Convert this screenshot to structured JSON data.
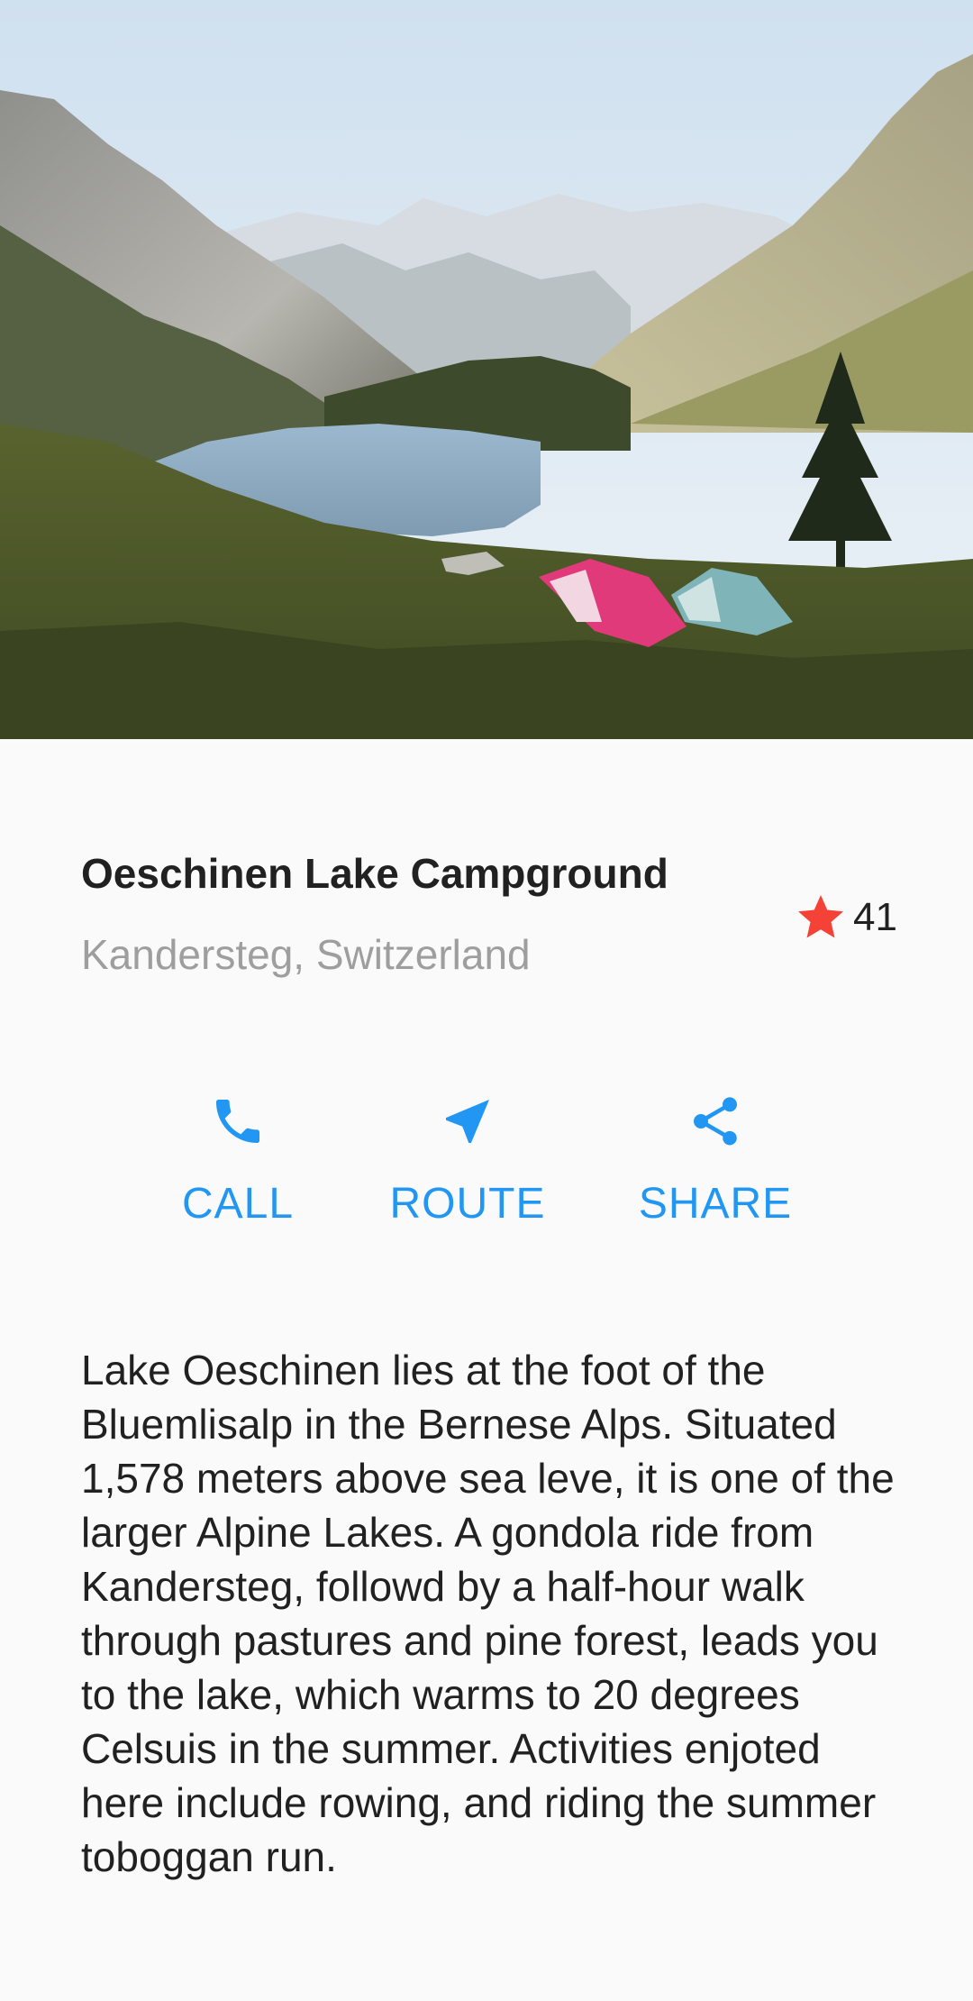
{
  "hero": {
    "image": "mountain-lake-campsite-photo",
    "colors": {
      "sky": "#dde9f4",
      "lake": "#7fa3bf",
      "grass": "#4f5a2a",
      "tent_pink": "#e03a7a",
      "tent_teal": "#7fb5b9"
    }
  },
  "place": {
    "title": "Oeschinen Lake Campground",
    "location": "Kandersteg, Switzerland",
    "rating_icon": "star-icon",
    "rating_count": "41",
    "rating_color": "#f44336"
  },
  "actions": [
    {
      "icon": "phone-icon",
      "label": "CALL"
    },
    {
      "icon": "navigation-arrow-icon",
      "label": "ROUTE"
    },
    {
      "icon": "share-icon",
      "label": "SHARE"
    }
  ],
  "accent_color": "#2196f3",
  "description": "Lake Oeschinen lies at the foot of the Bluemlisalp in the Bernese Alps. Situated 1,578 meters above sea leve, it is one of the larger Alpine Lakes. A gondola ride from Kandersteg, followd by a half-hour walk through pastures and pine forest, leads you to the lake, which warms to 20 degrees Celsuis in the summer. Activities enjoted here include rowing, and riding the summer toboggan run."
}
